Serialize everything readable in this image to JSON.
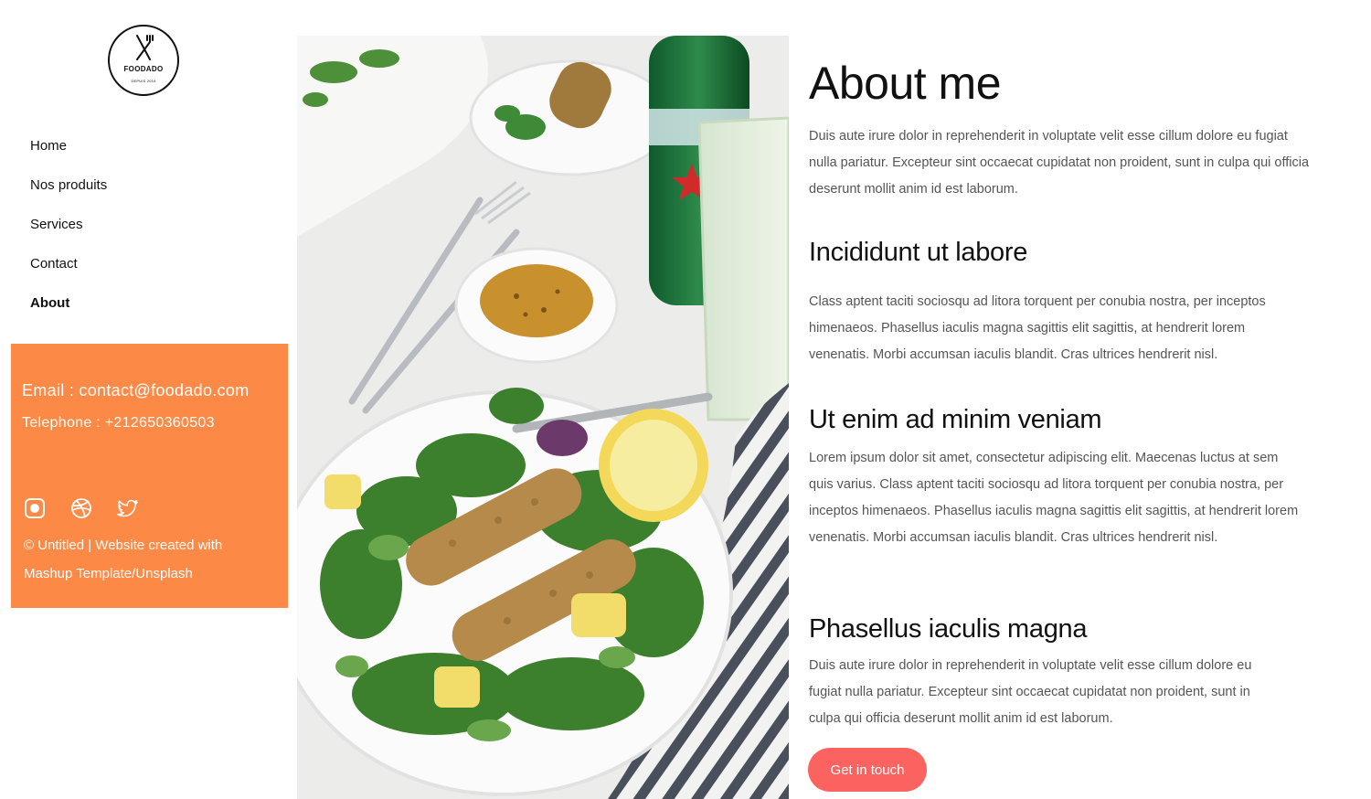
{
  "logo": {
    "brand": "FOODADO",
    "since": "DEPUIS 2019"
  },
  "nav": {
    "items": [
      {
        "label": "Home"
      },
      {
        "label": "Nos produits"
      },
      {
        "label": "Services"
      },
      {
        "label": "Contact"
      },
      {
        "label": "About"
      }
    ],
    "active": "About"
  },
  "contact": {
    "email": "Email : contact@foodado.com",
    "phone": "Telephone : +212650360503",
    "background_color": "#fd8946",
    "social_icons": [
      "instagram-icon",
      "dribbble-icon",
      "twitter-icon"
    ],
    "copyright_line1": "© Untitled | Website created with",
    "copyright_line2": "Mashup Template/Unsplash"
  },
  "main": {
    "title": "About me",
    "intro": "Duis aute irure dolor in reprehenderit in voluptate velit esse cillum dolore eu fugiat nulla pariatur. Excepteur sint occaecat cupidatat non proident, sunt in culpa qui officia deserunt mollit anim id est laborum.",
    "sections": [
      {
        "heading": "Incididunt ut labore",
        "text": "Class aptent taciti sociosqu ad litora torquent per conubia nostra, per inceptos himenaeos. Phasellus iaculis magna sagittis elit sagittis, at hendrerit lorem venenatis. Morbi accumsan iaculis blandit. Cras ultrices hendrerit nisl."
      },
      {
        "heading": "Ut enim ad minim veniam",
        "text": "Lorem ipsum dolor sit amet, consectetur adipiscing elit. Maecenas luctus at sem quis varius. Class aptent taciti sociosqu ad litora torquent per conubia nostra, per inceptos himenaeos. Phasellus iaculis magna sagittis elit sagittis, at hendrerit lorem venenatis. Morbi accumsan iaculis blandit. Cras ultrices hendrerit nisl."
      },
      {
        "heading": "Phasellus iaculis magna",
        "text": "Duis aute irure dolor in reprehenderit in voluptate velit esse cillum dolore eu fugiat nulla pariatur. Excepteur sint occaecat cupidatat non proident, sunt in culpa qui officia deserunt mollit anim id est laborum."
      }
    ],
    "cta_label": "Get in touch",
    "cta_color": "#fb6361"
  }
}
